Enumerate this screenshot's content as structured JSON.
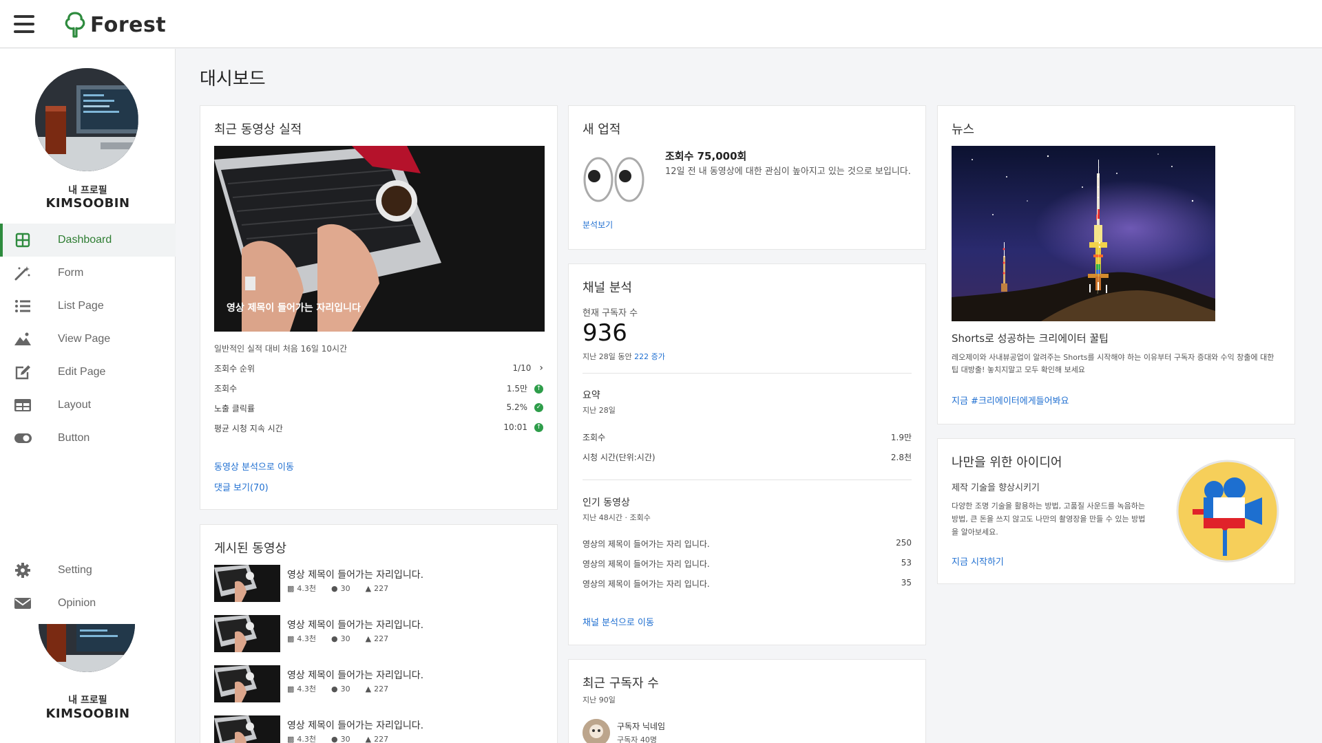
{
  "app": {
    "name": "Forest"
  },
  "colors": {
    "accent": "#2e8b3e",
    "link": "#1f6fd1",
    "up": "#2e9d4a"
  },
  "sidebar": {
    "profile_label": "내 프로필",
    "profile_name": "KIMSOOBIN",
    "items": [
      {
        "label": "Dashboard",
        "icon": "grid-icon",
        "active": true
      },
      {
        "label": "Form",
        "icon": "magic-wand-icon"
      },
      {
        "label": "List Page",
        "icon": "list-icon"
      },
      {
        "label": "View Page",
        "icon": "landscape-icon"
      },
      {
        "label": "Edit Page",
        "icon": "edit-icon"
      },
      {
        "label": "Layout",
        "icon": "layout-icon"
      },
      {
        "label": "Button",
        "icon": "toggle-icon"
      }
    ],
    "bottom_items": [
      {
        "label": "Setting",
        "icon": "gear-icon"
      },
      {
        "label": "Opinion",
        "icon": "envelope-icon"
      }
    ]
  },
  "main": {
    "page_title": "대시보드",
    "recent_performance": {
      "title": "최근 동영상 실적",
      "video_caption": "영상 제목이 들어가는 자리입니다",
      "summary": "일반적인 실적 대비 처음 16일 10시간",
      "stats": [
        {
          "label": "조회수 순위",
          "value": "1/10",
          "icon": "chevron-right-icon"
        },
        {
          "label": "조회수",
          "value": "1.5만",
          "icon": "arrow-up-icon"
        },
        {
          "label": "노출 클릭률",
          "value": "5.2%",
          "icon": "check-icon"
        },
        {
          "label": "평균 시청 지속 시간",
          "value": "10:01",
          "icon": "arrow-up-icon"
        }
      ],
      "link_analytics": "동영상 분석으로 이동",
      "link_comments": "댓글 보기(70)"
    },
    "published": {
      "title": "게시된 동영상",
      "videos": [
        {
          "title": "영상 제목이 들어가는 자리입니다.",
          "views": "4.3천",
          "comments": "30",
          "likes": "227"
        },
        {
          "title": "영상 제목이 들어가는 자리입니다.",
          "views": "4.3천",
          "comments": "30",
          "likes": "227"
        },
        {
          "title": "영상 제목이 들어가는 자리입니다.",
          "views": "4.3천",
          "comments": "30",
          "likes": "227"
        },
        {
          "title": "영상 제목이 들어가는 자리입니다.",
          "views": "4.3천",
          "comments": "30",
          "likes": "227"
        }
      ]
    },
    "achievement": {
      "title": "새 업적",
      "headline": "조회수 75,000회",
      "description": "12일 전 내 동영상에 대한 관심이 높아지고 있는 것으로 보입니다.",
      "link": "분석보기"
    },
    "channel": {
      "title": "채널 분석",
      "subs_label": "현재 구독자 수",
      "subs_value": "936",
      "subs_period": "지난 28일 동안",
      "subs_increase": "222 증가",
      "summary_title": "요약",
      "summary_period": "지난 28일",
      "summary_rows": [
        {
          "label": "조회수",
          "value": "1.9만"
        },
        {
          "label": "시청 시간(단위:시간)",
          "value": "2.8천"
        }
      ],
      "popular_title": "인기 동영상",
      "popular_period": "지난 48시간 · 조회수",
      "popular_rows": [
        {
          "label": "영상의 제목이 들어가는 자리 입니다.",
          "value": "250"
        },
        {
          "label": "영상의 제목이 들어가는 자리 입니다.",
          "value": "53"
        },
        {
          "label": "영상의 제목이 들어가는 자리 입니다.",
          "value": "35"
        }
      ],
      "link": "채널 분석으로 이동"
    },
    "recent_subs": {
      "title": "최근 구독자 수",
      "period": "지난 90일",
      "subscriber_name": "구독자 닉네임",
      "subscriber_count": "구독자 40명"
    },
    "news": {
      "title": "뉴스",
      "headline": "Shorts로 성공하는 크리에이터 꿀팁",
      "body": "레오제이와 사내뷰공업이 알려주는 Shorts를 시작해야 하는 이유부터 구독자 증대와 수익 창출에 대한 팁 대방출! 놓치지말고 모두 확인해 보세요",
      "link": "지금 #크리에이터에게들어봐요"
    },
    "idea": {
      "title": "나만을 위한 아이디어",
      "subtitle": "제작 기술을 향상시키기",
      "body": "다양한 조명 기술을 활용하는 방법, 고품질 사운드를 녹음하는 방법, 큰 돈을 쓰지 않고도 나만의 촬영장을 만들 수 있는 방법을 알아보세요.",
      "link": "지금 시작하기"
    }
  }
}
